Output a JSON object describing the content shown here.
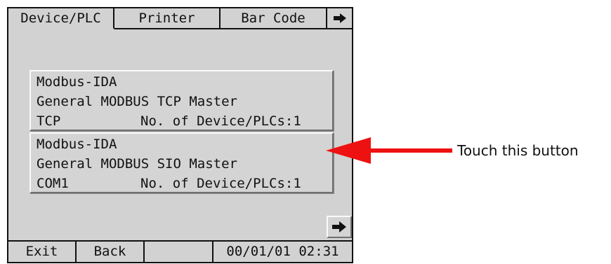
{
  "tabs": [
    {
      "label": "Device/PLC"
    },
    {
      "label": "Printer"
    },
    {
      "label": "Bar Code"
    }
  ],
  "tab_more_icon": "arrow-right-icon",
  "entries": [
    {
      "driver": "Modbus-IDA",
      "name": "General MODBUS TCP Master",
      "port": "TCP",
      "count": "No. of Device/PLCs:1"
    },
    {
      "driver": "Modbus-IDA",
      "name": "General MODBUS SIO Master",
      "port": "COM1",
      "count": "No. of Device/PLCs:1"
    }
  ],
  "next_icon": "arrow-right-icon",
  "statusbar": {
    "exit": "Exit",
    "back": "Back",
    "blank": "",
    "clock": "00/01/01 02:31"
  },
  "callout": {
    "text": "Touch this button",
    "color": "#ee1111"
  }
}
